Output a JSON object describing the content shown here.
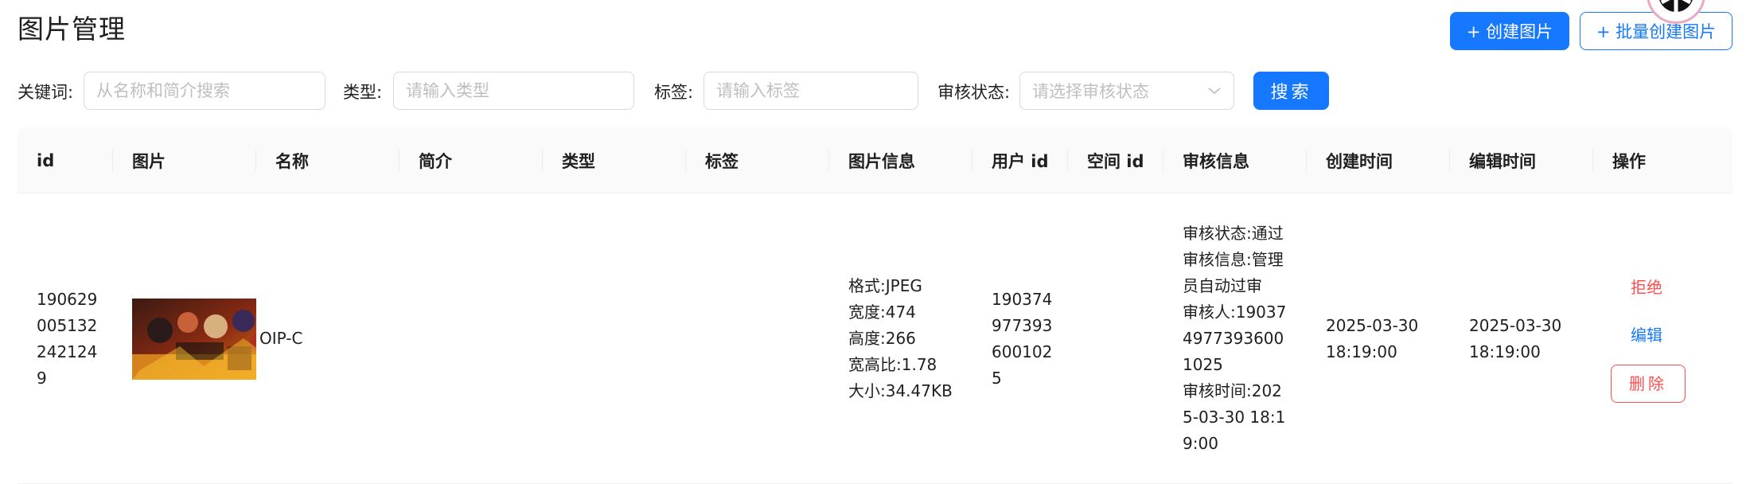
{
  "header": {
    "title": "图片管理",
    "create_label": "+ 创建图片",
    "batch_create_label": "+ 批量创建图片"
  },
  "search_form": {
    "keyword_label": "关键词:",
    "keyword_placeholder": "从名称和简介搜索",
    "type_label": "类型:",
    "type_placeholder": "请输入类型",
    "tags_label": "标签:",
    "tags_placeholder": "请输入标签",
    "review_status_label": "审核状态:",
    "review_status_placeholder": "请选择审核状态",
    "search_label": "搜索"
  },
  "table": {
    "columns": [
      "id",
      "图片",
      "名称",
      "简介",
      "类型",
      "标签",
      "图片信息",
      "用户 id",
      "空间 id",
      "审核信息",
      "创建时间",
      "编辑时间",
      "操作"
    ],
    "rows": [
      {
        "id": "1906290051322421249",
        "name": "OIP-C",
        "intro": "",
        "category": "",
        "tags": "",
        "pic_info": {
          "format": "格式:JPEG",
          "width": "宽度:474",
          "height": "高度:266",
          "ratio": "宽高比:1.78",
          "size": "大小:34.47KB"
        },
        "user_id": "1903749773936001025",
        "space_id": "",
        "review_info": {
          "status": "审核状态:通过",
          "message": "审核信息:管理员自动过审",
          "reviewer": "审核人:1903749773936001025",
          "time": "审核时间:2025-03-30 18:19:00"
        },
        "create_time": "2025-03-30 18:19:00",
        "edit_time": "2025-03-30 18:19:00",
        "actions": {
          "reject_label": "拒绝",
          "edit_label": "编辑",
          "delete_label": "删除"
        }
      }
    ]
  },
  "colors": {
    "primary": "#1677ff",
    "danger": "#ff4d4f",
    "header_bg": "#fafafa",
    "border": "#d9d9d9",
    "placeholder": "#bfbfbf"
  },
  "icons": {
    "avatar": "user-avatar-icon",
    "select_arrow": "chevron-down-icon"
  }
}
